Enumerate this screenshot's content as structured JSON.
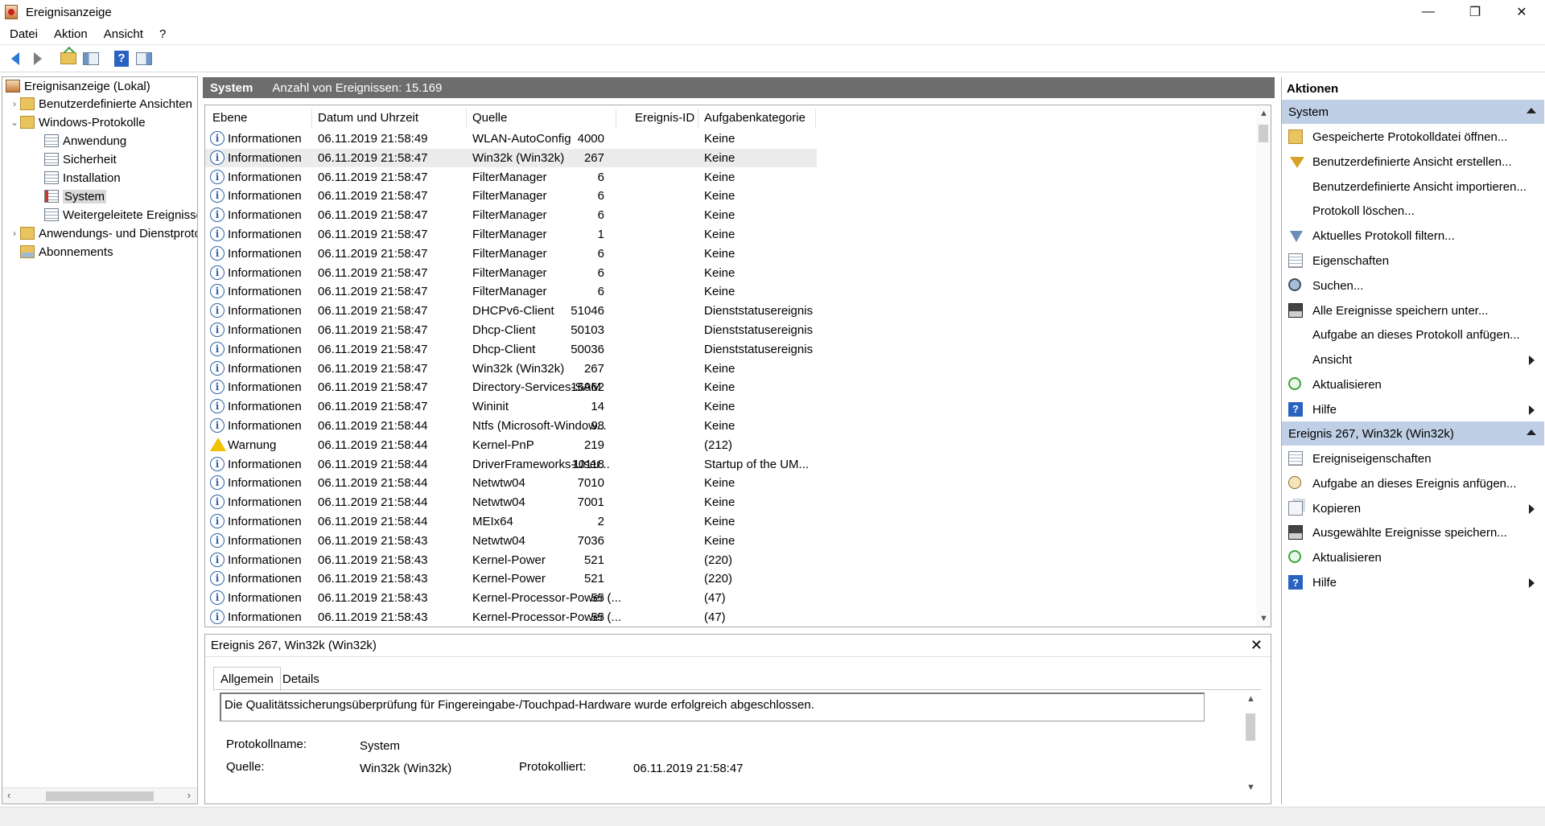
{
  "window": {
    "title": "Ereignisanzeige",
    "controls": {
      "minimize": "—",
      "maximize": "❐",
      "close": "✕"
    }
  },
  "menu": [
    "Datei",
    "Aktion",
    "Ansicht",
    "?"
  ],
  "toolbar": {
    "buttons": [
      "back-icon",
      "forward-icon",
      "open-folder-icon",
      "show-hide-tree-icon",
      "help-icon",
      "show-hide-action-pane-icon"
    ]
  },
  "tree": {
    "root": "Ereignisanzeige (Lokal)",
    "custom_views": "Benutzerdefinierte Ansichten",
    "windows_logs": "Windows-Protokolle",
    "application": "Anwendung",
    "security": "Sicherheit",
    "setup": "Installation",
    "system": "System",
    "forwarded": "Weitergeleitete Ereignisse",
    "apps_services": "Anwendungs- und Dienstprotokolle",
    "subscriptions": "Abonnements"
  },
  "center": {
    "log_name": "System",
    "event_count": "Anzahl von Ereignissen: 15.169",
    "columns": {
      "level": "Ebene",
      "date": "Datum und Uhrzeit",
      "source": "Quelle",
      "event_id": "Ereignis-ID",
      "category": "Aufgabenkategorie"
    },
    "rows": [
      {
        "level": "Informationen",
        "type": "info",
        "date": "06.11.2019 21:58:49",
        "source": "WLAN-AutoConfig",
        "id": "4000",
        "cat": "Keine"
      },
      {
        "level": "Informationen",
        "type": "info",
        "date": "06.11.2019 21:58:47",
        "source": "Win32k (Win32k)",
        "id": "267",
        "cat": "Keine"
      },
      {
        "level": "Informationen",
        "type": "info",
        "date": "06.11.2019 21:58:47",
        "source": "FilterManager",
        "id": "6",
        "cat": "Keine"
      },
      {
        "level": "Informationen",
        "type": "info",
        "date": "06.11.2019 21:58:47",
        "source": "FilterManager",
        "id": "6",
        "cat": "Keine"
      },
      {
        "level": "Informationen",
        "type": "info",
        "date": "06.11.2019 21:58:47",
        "source": "FilterManager",
        "id": "6",
        "cat": "Keine"
      },
      {
        "level": "Informationen",
        "type": "info",
        "date": "06.11.2019 21:58:47",
        "source": "FilterManager",
        "id": "1",
        "cat": "Keine"
      },
      {
        "level": "Informationen",
        "type": "info",
        "date": "06.11.2019 21:58:47",
        "source": "FilterManager",
        "id": "6",
        "cat": "Keine"
      },
      {
        "level": "Informationen",
        "type": "info",
        "date": "06.11.2019 21:58:47",
        "source": "FilterManager",
        "id": "6",
        "cat": "Keine"
      },
      {
        "level": "Informationen",
        "type": "info",
        "date": "06.11.2019 21:58:47",
        "source": "FilterManager",
        "id": "6",
        "cat": "Keine"
      },
      {
        "level": "Informationen",
        "type": "info",
        "date": "06.11.2019 21:58:47",
        "source": "DHCPv6-Client",
        "id": "51046",
        "cat": "Dienststatusereignis"
      },
      {
        "level": "Informationen",
        "type": "info",
        "date": "06.11.2019 21:58:47",
        "source": "Dhcp-Client",
        "id": "50103",
        "cat": "Dienststatusereignis"
      },
      {
        "level": "Informationen",
        "type": "info",
        "date": "06.11.2019 21:58:47",
        "source": "Dhcp-Client",
        "id": "50036",
        "cat": "Dienststatusereignis"
      },
      {
        "level": "Informationen",
        "type": "info",
        "date": "06.11.2019 21:58:47",
        "source": "Win32k (Win32k)",
        "id": "267",
        "cat": "Keine"
      },
      {
        "level": "Informationen",
        "type": "info",
        "date": "06.11.2019 21:58:47",
        "source": "Directory-Services-SAM",
        "id": "16962",
        "cat": "Keine"
      },
      {
        "level": "Informationen",
        "type": "info",
        "date": "06.11.2019 21:58:47",
        "source": "Wininit",
        "id": "14",
        "cat": "Keine"
      },
      {
        "level": "Informationen",
        "type": "info",
        "date": "06.11.2019 21:58:44",
        "source": "Ntfs (Microsoft-Window...",
        "id": "98",
        "cat": "Keine"
      },
      {
        "level": "Warnung",
        "type": "warn",
        "date": "06.11.2019 21:58:44",
        "source": "Kernel-PnP",
        "id": "219",
        "cat": "(212)"
      },
      {
        "level": "Informationen",
        "type": "info",
        "date": "06.11.2019 21:58:44",
        "source": "DriverFrameworks-User...",
        "id": "10118",
        "cat": "Startup of the UM..."
      },
      {
        "level": "Informationen",
        "type": "info",
        "date": "06.11.2019 21:58:44",
        "source": "Netwtw04",
        "id": "7010",
        "cat": "Keine"
      },
      {
        "level": "Informationen",
        "type": "info",
        "date": "06.11.2019 21:58:44",
        "source": "Netwtw04",
        "id": "7001",
        "cat": "Keine"
      },
      {
        "level": "Informationen",
        "type": "info",
        "date": "06.11.2019 21:58:44",
        "source": "MEIx64",
        "id": "2",
        "cat": "Keine"
      },
      {
        "level": "Informationen",
        "type": "info",
        "date": "06.11.2019 21:58:43",
        "source": "Netwtw04",
        "id": "7036",
        "cat": "Keine"
      },
      {
        "level": "Informationen",
        "type": "info",
        "date": "06.11.2019 21:58:43",
        "source": "Kernel-Power",
        "id": "521",
        "cat": "(220)"
      },
      {
        "level": "Informationen",
        "type": "info",
        "date": "06.11.2019 21:58:43",
        "source": "Kernel-Power",
        "id": "521",
        "cat": "(220)"
      },
      {
        "level": "Informationen",
        "type": "info",
        "date": "06.11.2019 21:58:43",
        "source": "Kernel-Processor-Power (...",
        "id": "55",
        "cat": "(47)"
      },
      {
        "level": "Informationen",
        "type": "info",
        "date": "06.11.2019 21:58:43",
        "source": "Kernel-Processor-Power (...",
        "id": "55",
        "cat": "(47)"
      }
    ],
    "selected_row": 1
  },
  "detail": {
    "title": "Ereignis 267, Win32k (Win32k)",
    "tabs": [
      "Allgemein",
      "Details"
    ],
    "description": "Die Qualitätssicherungsüberprüfung für Fingereingabe-/Touchpad-Hardware wurde erfolgreich abgeschlossen.",
    "protocol_label": "Protokollname:",
    "protocol_value": "System",
    "source_label": "Quelle:",
    "source_value": "Win32k (Win32k)",
    "logged_label": "Protokolliert:",
    "logged_value": "06.11.2019 21:58:47"
  },
  "actions": {
    "title": "Aktionen",
    "section1": "System",
    "items1": [
      {
        "label": "Gespeicherte Protokolldatei öffnen...",
        "icon": "open-folder-icon",
        "sub": false
      },
      {
        "label": "Benutzerdefinierte Ansicht erstellen...",
        "icon": "filter-icon",
        "sub": false
      },
      {
        "label": "Benutzerdefinierte Ansicht importieren...",
        "icon": "",
        "sub": false
      },
      {
        "label": "Protokoll löschen...",
        "icon": "",
        "sub": false
      },
      {
        "label": "Aktuelles Protokoll filtern...",
        "icon": "filter-log-icon",
        "sub": false
      },
      {
        "label": "Eigenschaften",
        "icon": "properties-icon",
        "sub": false
      },
      {
        "label": "Suchen...",
        "icon": "find-icon",
        "sub": false
      },
      {
        "label": "Alle Ereignisse speichern unter...",
        "icon": "save-icon",
        "sub": false
      },
      {
        "label": "Aufgabe an dieses Protokoll anfügen...",
        "icon": "",
        "sub": false
      },
      {
        "label": "Ansicht",
        "icon": "",
        "sub": true
      },
      {
        "label": "Aktualisieren",
        "icon": "refresh-icon",
        "sub": false
      },
      {
        "label": "Hilfe",
        "icon": "help-icon",
        "sub": true
      }
    ],
    "section2": "Ereignis 267, Win32k (Win32k)",
    "items2": [
      {
        "label": "Ereigniseigenschaften",
        "icon": "properties-icon",
        "sub": false
      },
      {
        "label": "Aufgabe an dieses Ereignis anfügen...",
        "icon": "task-icon",
        "sub": false
      },
      {
        "label": "Kopieren",
        "icon": "copy-icon",
        "sub": true
      },
      {
        "label": "Ausgewählte Ereignisse speichern...",
        "icon": "save-icon",
        "sub": false
      },
      {
        "label": "Aktualisieren",
        "icon": "refresh-icon",
        "sub": false
      },
      {
        "label": "Hilfe",
        "icon": "help-icon",
        "sub": true
      }
    ]
  }
}
